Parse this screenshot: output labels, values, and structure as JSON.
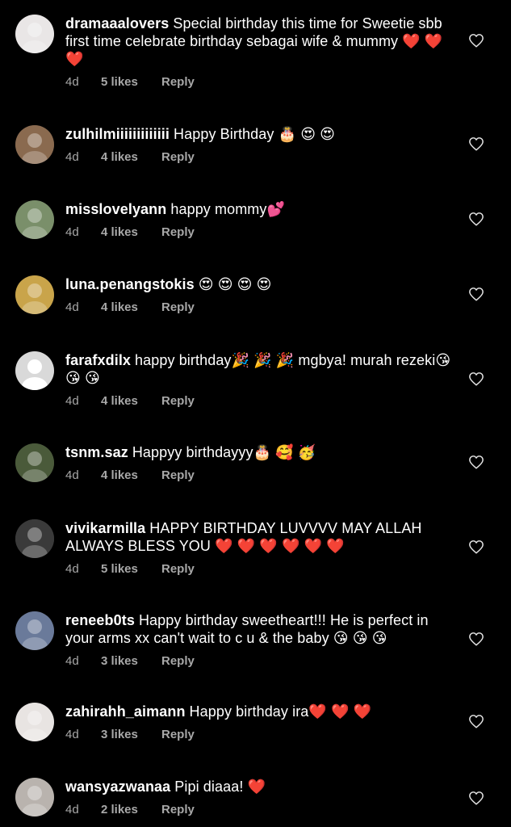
{
  "comments": [
    {
      "username": "dramaaalovers",
      "text": "Special birthday this time for Sweetie sbb first time celebrate birthday sebagai wife & mummy ❤️ ❤️ ❤️",
      "time": "4d",
      "likes": "5 likes",
      "reply": "Reply",
      "avatar_color": "#e9e6e6"
    },
    {
      "username": "zulhilmiiiiiiiiiiiii",
      "text": "Happy Birthday 🎂 😍 😍",
      "time": "4d",
      "likes": "4 likes",
      "reply": "Reply",
      "avatar_color": "#8a6a4f"
    },
    {
      "username": "misslovelyann",
      "text": "happy mommy💕",
      "time": "4d",
      "likes": "4 likes",
      "reply": "Reply",
      "avatar_color": "#7a8f6a"
    },
    {
      "username": "luna.penangstokis",
      "text": "😍 😍 😍 😍",
      "time": "4d",
      "likes": "4 likes",
      "reply": "Reply",
      "avatar_color": "#c9a44a"
    },
    {
      "username": "farafxdilx",
      "text": "happy birthday🎉 🎉 🎉 mgbya! murah rezeki😘 😘 😘",
      "time": "4d",
      "likes": "4 likes",
      "reply": "Reply",
      "avatar_color": "#d9d9d9"
    },
    {
      "username": "tsnm.saz",
      "text": "Happyy birthdayyy🎂 🥰 🥳",
      "time": "4d",
      "likes": "4 likes",
      "reply": "Reply",
      "avatar_color": "#4a5a3a"
    },
    {
      "username": "vivikarmilla",
      "text": "HAPPY BIRTHDAY LUVVVV MAY ALLAH ALWAYS BLESS YOU ❤️ ❤️ ❤️ ❤️ ❤️ ❤️",
      "time": "4d",
      "likes": "5 likes",
      "reply": "Reply",
      "avatar_color": "#3a3a3a"
    },
    {
      "username": "reneeb0ts",
      "text": "Happy birthday sweetheart!!! He is perfect in your arms xx can't wait to c u & the baby 😘 😘 😘",
      "time": "4d",
      "likes": "3 likes",
      "reply": "Reply",
      "avatar_color": "#6a7a9a"
    },
    {
      "username": "zahirahh_aimann",
      "text": "Happy birthday ira❤️ ❤️ ❤️",
      "time": "4d",
      "likes": "3 likes",
      "reply": "Reply",
      "avatar_color": "#e8e4e2"
    },
    {
      "username": "wansyazwanaa",
      "text": "Pipi diaaa! ❤️",
      "time": "4d",
      "likes": "2 likes",
      "reply": "Reply",
      "avatar_color": "#b9b3ae"
    }
  ],
  "colors": {
    "background": "#000000",
    "text": "#ffffff",
    "meta": "#a8a8a8"
  },
  "icons": {
    "like": "heart-outline-icon",
    "avatar_default": "default-user-icon"
  }
}
